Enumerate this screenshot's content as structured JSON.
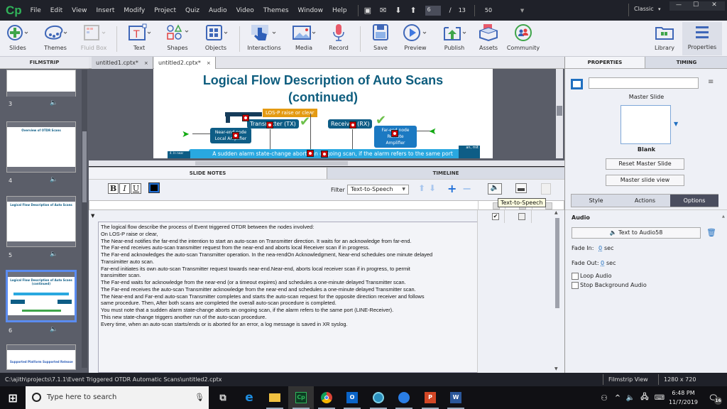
{
  "app": {
    "logo": "Cp",
    "menu": [
      "File",
      "Edit",
      "View",
      "Insert",
      "Modify",
      "Project",
      "Quiz",
      "Audio",
      "Video",
      "Themes",
      "Window",
      "Help"
    ],
    "current_slide": "6",
    "slide_separator": "/",
    "total_slides": "13",
    "zoom": "50",
    "workspace": "Classic",
    "workspace_caret": "▾",
    "window_controls": {
      "minimize": "—",
      "maximize": "☐",
      "close": "✕"
    }
  },
  "toolbar": {
    "items": [
      {
        "label": "Slides",
        "icon": "add-slide-icon"
      },
      {
        "label": "Themes",
        "icon": "palette-icon"
      },
      {
        "label": "Fluid Box",
        "icon": "fluid-box-icon",
        "disabled": true
      },
      {
        "label": "Text",
        "icon": "text-icon"
      },
      {
        "label": "Shapes",
        "icon": "shapes-icon"
      },
      {
        "label": "Objects",
        "icon": "objects-icon"
      },
      {
        "label": "Interactions",
        "icon": "hand-pointer-icon"
      },
      {
        "label": "Media",
        "icon": "image-icon"
      },
      {
        "label": "Record",
        "icon": "microphone-icon"
      },
      {
        "label": "Save",
        "icon": "floppy-icon"
      },
      {
        "label": "Preview",
        "icon": "play-icon"
      },
      {
        "label": "Publish",
        "icon": "publish-icon"
      },
      {
        "label": "Assets",
        "icon": "assets-box-icon"
      },
      {
        "label": "Community",
        "icon": "community-icon"
      },
      {
        "label": "Library",
        "icon": "library-folder-icon"
      },
      {
        "label": "Properties",
        "icon": "properties-lines-icon"
      }
    ]
  },
  "filmstrip": {
    "header": "FILMSTRIP",
    "slides": [
      {
        "number": "3",
        "title": ""
      },
      {
        "number": "4",
        "title": "Overview of OTDR Scans"
      },
      {
        "number": "5",
        "title": "Logical Flow Description of Auto Scans"
      },
      {
        "number": "6",
        "title": "Logical Flow Description of Auto Scans (continued)",
        "selected": true
      },
      {
        "number": "",
        "title": "Supported Platform   Supported Release"
      }
    ],
    "audio_icon": "🔈"
  },
  "doc_tabs": [
    {
      "label": "untitled1.cptx*",
      "close": "×",
      "active": false
    },
    {
      "label": "untitled2.cptx*",
      "close": "×",
      "active": true
    }
  ],
  "slide": {
    "title_line1": "Logical Flow Description of Auto Scans",
    "title_line2": "(continued)",
    "los_label": "LOS-P raise or clear",
    "tx_label": "Transmitter (TX)",
    "rx_label": "Receiver (RX)",
    "near_node": "Near-end node\nLocal Amplifier",
    "far_node": "Far-end node\nRemote Amplifier",
    "banner": "A sudden alarm state-change aborts an ongoing scan, if the alarm refers to the same port",
    "left_side": "4. In near",
    "right_side": "an, mit"
  },
  "bottom_tabs": {
    "notes": "SLIDE NOTES",
    "timeline": "TIMELINE"
  },
  "notes_toolbar": {
    "bold": "B",
    "italic": "I",
    "underline": "U",
    "filter_label": "Filter",
    "filter_value": "Text-to-Speech",
    "tooltip": "Text-to-Speech"
  },
  "notes": {
    "tts_checked": true,
    "cc_checked": false,
    "lines": [
      "The logical flow describe the process of Event triggered OTDR between the nodes involved:",
      "On LOS-P raise or clear,",
      "The Near-end notifies the far-end the intention to start an auto-scan on Transmitter direction.  It waits for an acknowledge from far-end.",
      "The Far-end receives auto-scan transmitter request from the near-end and aborts local Receiver scan if in progress.",
      "The Far-end acknowledges the auto-scan Transmitter operation. In the nea-rendOn Acknowledgment, Near-end schedules one minute delayed",
      "Transimitter auto scan.",
      "Far-end initiates its own auto-scan Transmitter request towards near-end.Near-end, aborts local receiver scan if in progress, to permit",
      "transimitter scan.",
      "The Far-end waits for acknowledge from the near-end (or a timeout expires) and schedules a one-minute delayed Transmitter scan.",
      "The Far-end receives the auto-scan Transmitter acknowledge from the near-end and schedules a one-minute delayed Transmitter scan.",
      "The Near-end and Far-end auto-scan Transmitter completes and starts the auto-scan request for the opposite direction receiver and follows",
      "same procedure. Then, After both scans are completed the overall auto-scan procedure is completed.",
      "You must note that a sudden alarm state-change aborts an ongoing scan, if the alarm refers to the same port (LINE-Receiver).",
      "This new state-change triggers another run of the auto-scan procedure.",
      "Every time, when an auto-scan starts/ends or is aborted for an error, a log message is saved in XR syslog."
    ]
  },
  "properties": {
    "tabs": {
      "properties": "PROPERTIES",
      "timing": "TIMING"
    },
    "name_value": "",
    "master_slide_label": "Master Slide",
    "master_name": "Blank",
    "reset_btn": "Reset Master Slide",
    "view_btn": "Master slide view",
    "subtabs": [
      "Style",
      "Actions",
      "Options"
    ],
    "active_subtab": "Options",
    "audio_heading": "Audio",
    "audio_btn": "Text to Audio58",
    "fade_in_label": "Fade In:",
    "fade_in_value": "0",
    "fade_out_label": "Fade Out:",
    "fade_out_value": "0",
    "sec": "sec",
    "loop_audio": "Loop Audio",
    "stop_bg_audio": "Stop Background Audio",
    "loop_checked": false,
    "stop_checked": false
  },
  "statusbar": {
    "path": "C:\\ajith\\projects\\7.1.1\\Event Triggered  OTDR Automatic Scans\\untitled2.cptx",
    "view": "Filmstrip View",
    "resolution": "1280 x 720"
  },
  "taskbar": {
    "search_placeholder": "Type here to search",
    "time": "6:48 PM",
    "date": "11/7/2019",
    "notifications": "16"
  }
}
